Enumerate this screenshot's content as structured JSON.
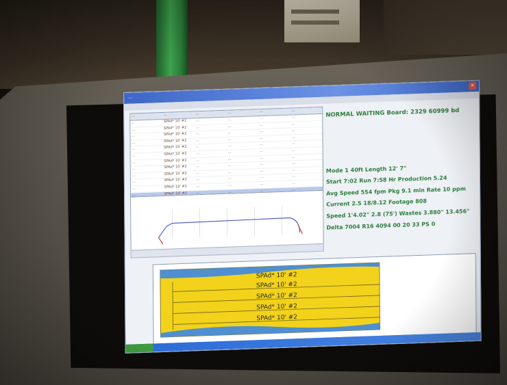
{
  "photo": {
    "subject": "factory-monitor-photo"
  },
  "window": {
    "title": "...",
    "close_glyph": "✕"
  },
  "table": {
    "headers": [
      "...",
      "...",
      "...",
      "...",
      "...",
      "..."
    ],
    "rows": [
      [
        "...",
        "SPAd* 10' #2",
        "...",
        "...",
        "...",
        "..."
      ],
      [
        "...",
        "SPAd* 10' #2",
        "...",
        "...",
        "...",
        "..."
      ],
      [
        "...",
        "SPAd* 10' #2",
        "...",
        "...",
        "...",
        "..."
      ],
      [
        "...",
        "SPAd* 10' #2",
        "...",
        "...",
        "...",
        "..."
      ],
      [
        "...",
        "SPAd* 10' #2",
        "...",
        "...",
        "...",
        "..."
      ],
      [
        "...",
        "SPAd* 10' #2",
        "...",
        "...",
        "...",
        "..."
      ],
      [
        "...",
        "SPAd* 10' #2",
        "...",
        "...",
        "...",
        "..."
      ],
      [
        "...",
        "SPAd* 10' #2",
        "...",
        "...",
        "...",
        "..."
      ],
      [
        "...",
        "SPAd* 10' #2",
        "...",
        "...",
        "...",
        "..."
      ],
      [
        "...",
        "SPAd* 10' #2",
        "...",
        "...",
        "...",
        "..."
      ],
      [
        "...",
        "SPAd* 10' #2",
        "...",
        "...",
        "...",
        "..."
      ],
      [
        "...",
        "SPAd* 10' #2",
        "...",
        "...",
        "...",
        "..."
      ]
    ],
    "selected_row": 11
  },
  "status": {
    "headline": "NORMAL WAITING   Board: 2329   60999 bd",
    "lines": [
      "Mode 1  40ft   Length 12' 7\"",
      "Start 7:02  Run 7:58  Hr Production 5.24",
      "Avg Speed 554 fpm  Pkg 9.1 min  Rate 10 ppm",
      "Current 2.5 18/8.12   Footage 808",
      "Speed 1'4.02\" 2.8 (75')  Wastes 3.880\" 13.456\"",
      "Delta  7004 R16 4094 00 20 33 PS 0"
    ]
  },
  "layup_boards": [
    "SPAd* 10' #2",
    "SPAd* 10' #2",
    "SPAd* 10' #2",
    "SPAd* 10' #2",
    "SPAd* 10' #2"
  ],
  "colors": {
    "status_text": "#2e7d3e",
    "board_fill": "#f2d21b",
    "board_curve": "#4f8fd0",
    "graph_line": "#5560c8",
    "graph_accent": "#d23b2f",
    "titlebar": "#3d67c7",
    "pipe": "#3ea24e"
  }
}
